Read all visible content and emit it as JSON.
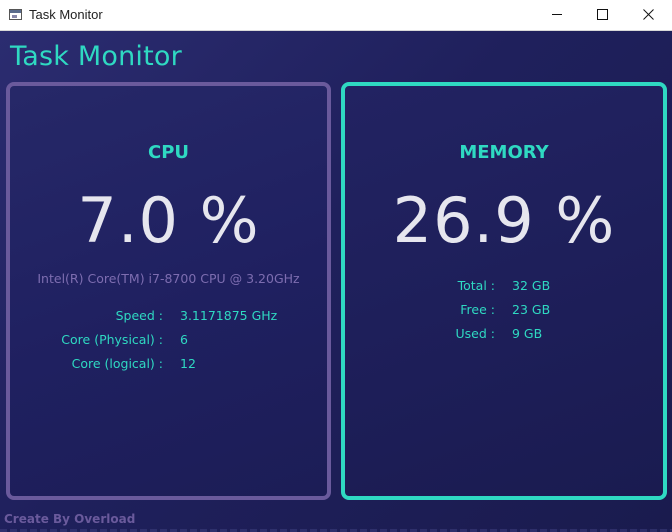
{
  "window": {
    "title": "Task Monitor"
  },
  "header": {
    "title": "Task Monitor"
  },
  "cpu": {
    "title": "CPU",
    "usage": "7.0 %",
    "model": "Intel(R) Core(TM) i7-8700 CPU @ 3.20GHz",
    "stats": [
      {
        "label": "Speed :",
        "value": "3.1171875 GHz"
      },
      {
        "label": "Core (Physical) :",
        "value": "6"
      },
      {
        "label": "Core (logical) :",
        "value": "12"
      }
    ]
  },
  "memory": {
    "title": "MEMORY",
    "usage": "26.9 %",
    "stats": [
      {
        "label": "Total :",
        "value": "32 GB"
      },
      {
        "label": "Free :",
        "value": "23 GB"
      },
      {
        "label": "Used :",
        "value": "9 GB"
      }
    ]
  },
  "footer": {
    "credit": "Create By Overload"
  },
  "colors": {
    "accent_teal": "#2fd9c2",
    "accent_purple": "#6a5a9c",
    "background": "#1e1f55",
    "value_text": "#e6e6ee"
  },
  "icons": {
    "app": "window-app-icon",
    "minimize": "minimize-icon",
    "maximize": "maximize-icon",
    "close": "close-icon"
  }
}
